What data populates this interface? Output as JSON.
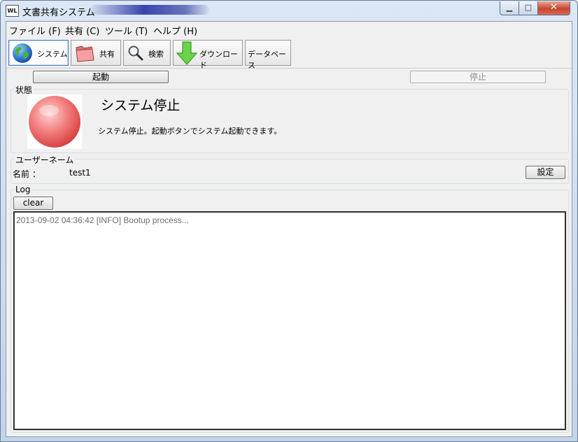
{
  "window": {
    "title": "文書共有システム",
    "icon_text": "WL",
    "controls": {
      "minimize": "▁",
      "maximize": "□",
      "close": "✕"
    }
  },
  "menu": [
    "ファイル (F)",
    "共有 (C)",
    "ツール (T)",
    "ヘルプ (H)"
  ],
  "tabs": [
    {
      "label": "システム",
      "icon": "globe-icon",
      "active": true
    },
    {
      "label": "共有",
      "icon": "folder-icon",
      "active": false
    },
    {
      "label": "検索",
      "icon": "search-icon",
      "active": false
    },
    {
      "label": "ダウンロード",
      "icon": "download-arrow-icon",
      "active": false
    },
    {
      "label": "データベース",
      "icon": "",
      "active": false
    }
  ],
  "system": {
    "start_label": "起動",
    "stop_label": "停止",
    "status_group_label": "状態",
    "status_title": "システム停止",
    "status_message": "システム停止。起動ボタンでシステム起動できます。",
    "status_color": "#e84a4a"
  },
  "user": {
    "group_label": "ユーザーネーム",
    "name_label": "名前 ：",
    "name_value": "test1",
    "settings_label": "設定"
  },
  "log": {
    "group_label": "Log",
    "clear_label": "clear",
    "lines": [
      "2013-09-02 04:36:42 [INFO] Bootup process..."
    ]
  }
}
